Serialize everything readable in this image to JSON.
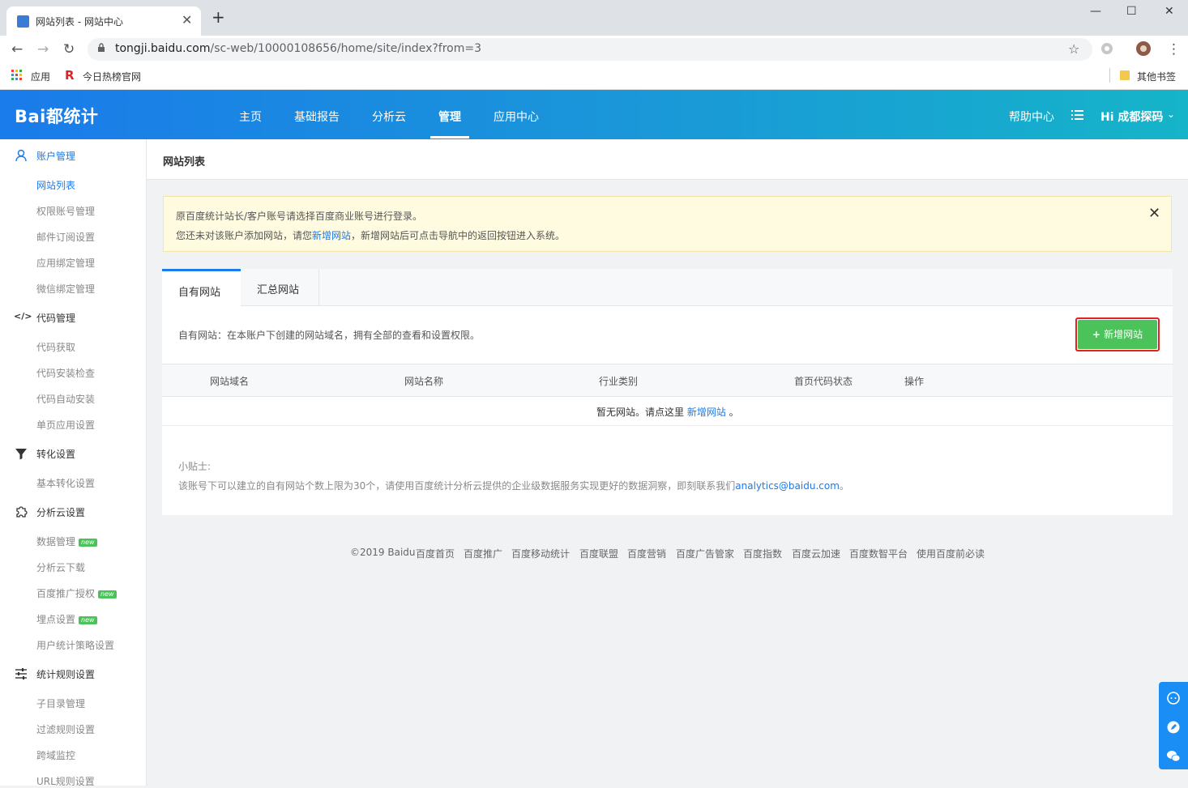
{
  "browser": {
    "tab_title": "网站列表 - 网站中心",
    "url_host": "tongji.baidu.com",
    "url_path": "/sc-web/10000108656/home/site/index?from=3",
    "bookmarks": [
      "应用",
      "今日热榜官网"
    ],
    "other_bookmarks": "其他书签"
  },
  "header": {
    "logo": "Bai都统计",
    "nav": [
      "主页",
      "基础报告",
      "分析云",
      "管理",
      "应用中心"
    ],
    "help": "帮助中心",
    "user": "Hi  成都探码"
  },
  "sidebar": {
    "groups": [
      {
        "label": "账户管理",
        "items": [
          "网站列表",
          "权限账号管理",
          "邮件订阅设置",
          "应用绑定管理",
          "微信绑定管理"
        ]
      },
      {
        "label": "代码管理",
        "items": [
          "代码获取",
          "代码安装检查",
          "代码自动安装",
          "单页应用设置"
        ]
      },
      {
        "label": "转化设置",
        "items": [
          "基本转化设置"
        ]
      },
      {
        "label": "分析云设置",
        "items": [
          "数据管理",
          "分析云下载",
          "百度推广授权",
          "埋点设置",
          "用户统计策略设置"
        ]
      },
      {
        "label": "统计规则设置",
        "items": [
          "子目录管理",
          "过滤规则设置",
          "跨域监控",
          "URL规则设置"
        ]
      }
    ],
    "new_badge": "new"
  },
  "main": {
    "page_title": "网站列表",
    "alert": {
      "line1": "原百度统计站长/客户账号请选择百度商业账号进行登录。",
      "line2_pre": "您还未对该账户添加网站，请您",
      "line2_link": "新增网站",
      "line2_post": "，新增网站后可点击导航中的返回按钮进入系统。"
    },
    "tabs": [
      "自有网站",
      "汇总网站"
    ],
    "description": "自有网站：在本账户下创建的网站域名，拥有全部的查看和设置权限。",
    "add_button": "新增网站",
    "table_headers": [
      "网站域名",
      "网站名称",
      "行业类别",
      "首页代码状态",
      "操作"
    ],
    "empty_pre": "暂无网站。请点这里 ",
    "empty_link": "新增网站",
    "empty_post": " 。",
    "tip_title": "小贴士:",
    "tip_text": "该账号下可以建立的自有网站个数上限为30个，请使用百度统计分析云提供的企业级数据服务实现更好的数据洞察，即刻联系我们",
    "tip_email": "analytics@baidu.com",
    "tip_end": "。"
  },
  "footer": [
    "©2019 Baidu",
    "百度首页",
    "百度推广",
    "百度移动统计",
    "百度联盟",
    "百度营销",
    "百度广告管家",
    "百度指数",
    "百度云加速",
    "百度数智平台",
    "使用百度前必读"
  ],
  "colors": {
    "brand": "#1a7bea",
    "add_button": "#4cc35a",
    "highlight": "#e02222"
  }
}
